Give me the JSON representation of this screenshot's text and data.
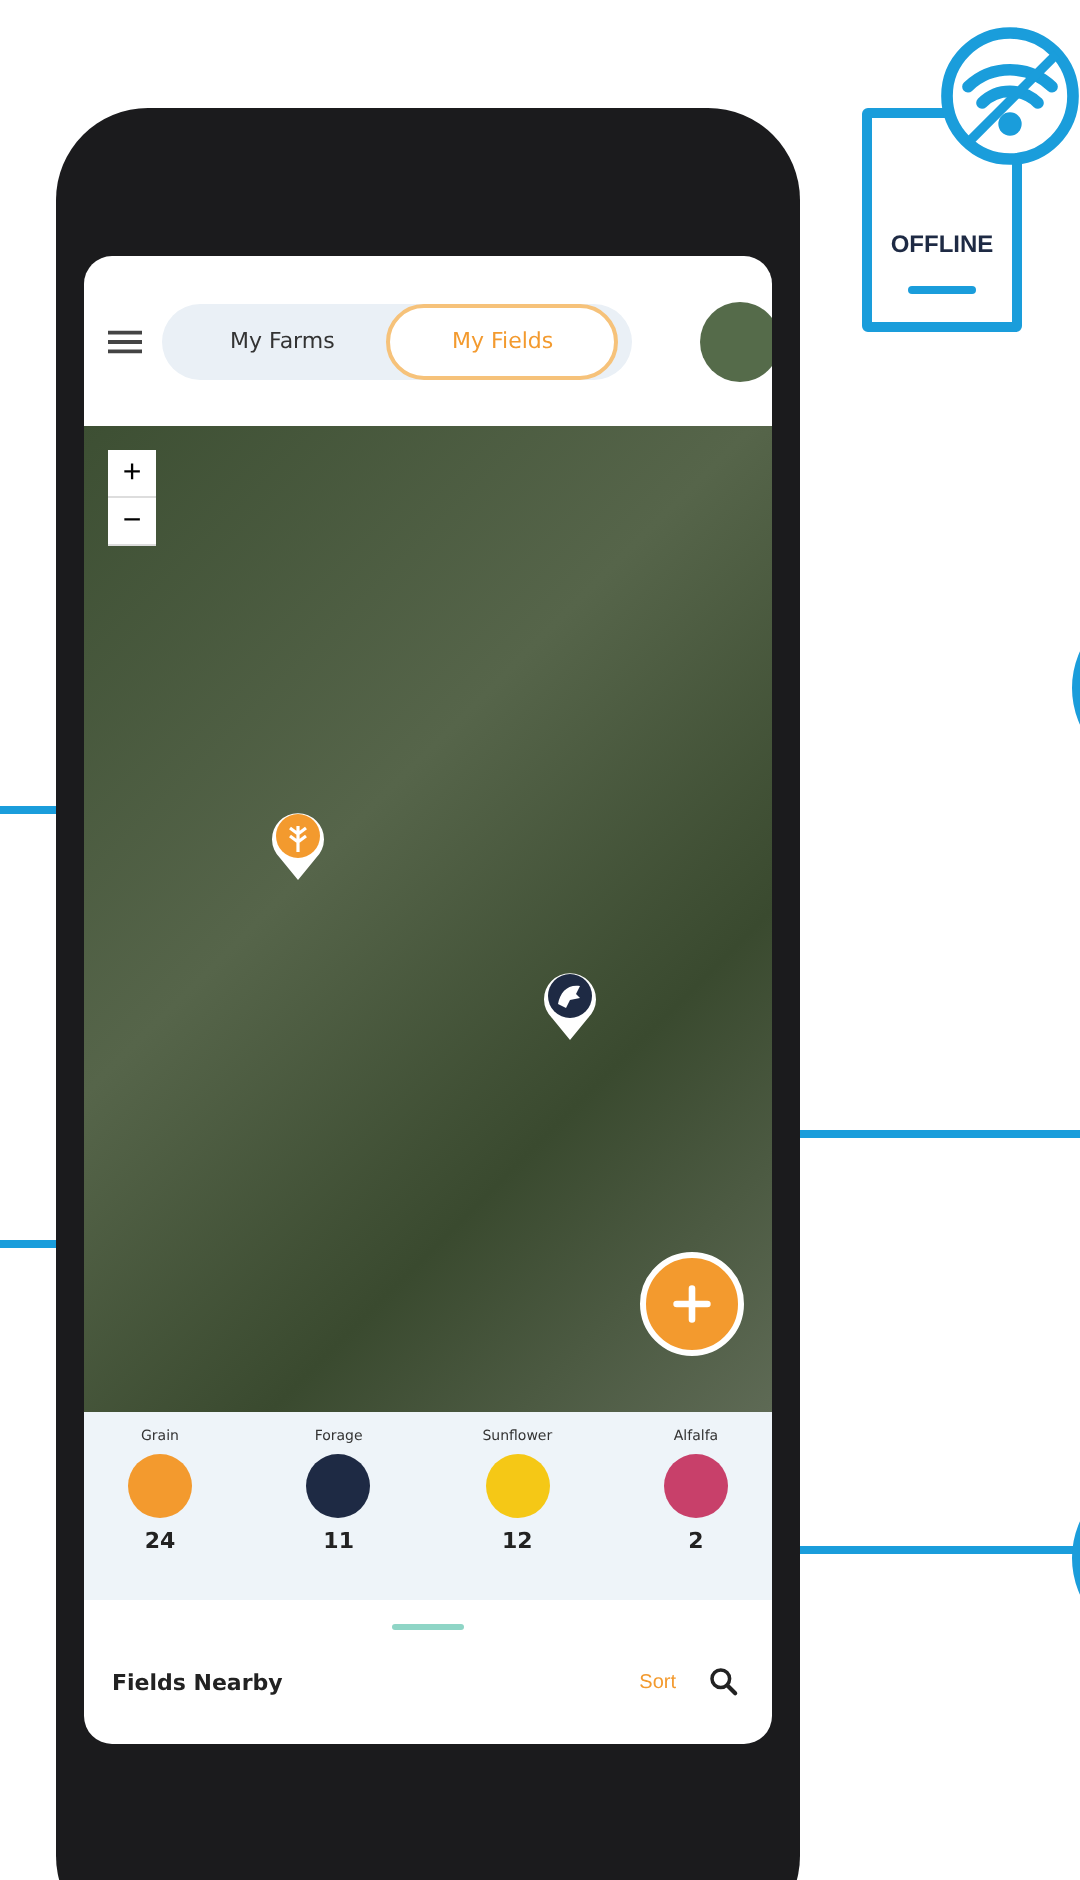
{
  "offline_badge": {
    "label": "OFFLINE"
  },
  "header": {
    "tabs": [
      {
        "label": "My Farms",
        "selected": false
      },
      {
        "label": "My Fields",
        "selected": true
      }
    ]
  },
  "map": {
    "zoom_in": "+",
    "zoom_out": "−",
    "pins": [
      {
        "kind": "grain",
        "color": "#f39a2e"
      },
      {
        "kind": "forage",
        "color": "#1e2a44"
      }
    ]
  },
  "categories": [
    {
      "name": "Grain",
      "count": "24",
      "color": "#f39a2e"
    },
    {
      "name": "Forage",
      "count": "11",
      "color": "#1e2a44"
    },
    {
      "name": "Sunflower",
      "count": "12",
      "color": "#f5c816"
    },
    {
      "name": "Alfalfa",
      "count": "2",
      "color": "#c8406a"
    }
  ],
  "bottom_sheet": {
    "title": "Fields Nearby",
    "sort": "Sort"
  }
}
